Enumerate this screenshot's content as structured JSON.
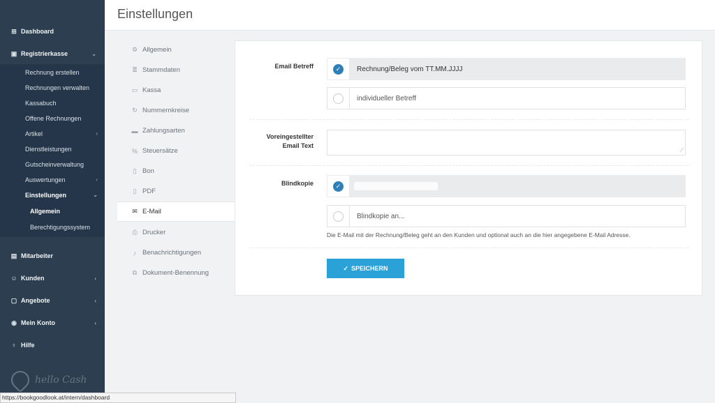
{
  "page": {
    "title": "Einstellungen"
  },
  "sidebar": {
    "dashboard": "Dashboard",
    "registrierkasse": "Registrierkasse",
    "sub_items": [
      "Rechnung erstellen",
      "Rechnungen verwalten",
      "Kassabuch",
      "Offene Rechnungen",
      "Artikel",
      "Dienstleistungen",
      "Gutscheinverwaltung",
      "Auswertungen",
      "Einstellungen"
    ],
    "einstellungen_sub": [
      "Allgemein",
      "Berechtigungssystem"
    ],
    "mitarbeiter": "Mitarbeiter",
    "kunden": "Kunden",
    "angebote": "Angebote",
    "mein_konto": "Mein Konto",
    "hilfe": "Hilfe",
    "logo_text": "hello Cash"
  },
  "settings_menu": [
    {
      "label": "Allgemein",
      "icon": "gear-icon"
    },
    {
      "label": "Stammdaten",
      "icon": "database-icon"
    },
    {
      "label": "Kassa",
      "icon": "monitor-icon"
    },
    {
      "label": "Nummernkreise",
      "icon": "refresh-icon"
    },
    {
      "label": "Zahlungsarten",
      "icon": "credit-card-icon"
    },
    {
      "label": "Steuersätze",
      "icon": "percent-icon"
    },
    {
      "label": "Bon",
      "icon": "document-icon"
    },
    {
      "label": "PDF",
      "icon": "document-icon"
    },
    {
      "label": "E-Mail",
      "icon": "envelope-icon",
      "active": true
    },
    {
      "label": "Drucker",
      "icon": "printer-icon"
    },
    {
      "label": "Benachrichtigungen",
      "icon": "bell-icon"
    },
    {
      "label": "Dokument-Benennung",
      "icon": "sitemap-icon"
    }
  ],
  "form": {
    "email_betreff_label": "Email Betreff",
    "betreff_option_1": "Rechnung/Beleg vom TT.MM.JJJJ",
    "betreff_option_2": "individueller Betreff",
    "email_text_label_1": "Voreingestellter",
    "email_text_label_2": "Email Text",
    "email_text_value": "",
    "blindkopie_label": "Blindkopie",
    "blindkopie_placeholder": "Blindkopie an...",
    "help_text": "Die E-Mail mit der Rechnung/Beleg geht an den Kunden und optional auch an die hier angegebene E-Mail Adresse.",
    "save_label": "SPEICHERN"
  },
  "status_url": "https://bookgoodlook.at/intern/dashboard",
  "colors": {
    "sidebar": "#2c3e50",
    "accent": "#2aa2d8",
    "radio_checked": "#2f7fb8"
  }
}
